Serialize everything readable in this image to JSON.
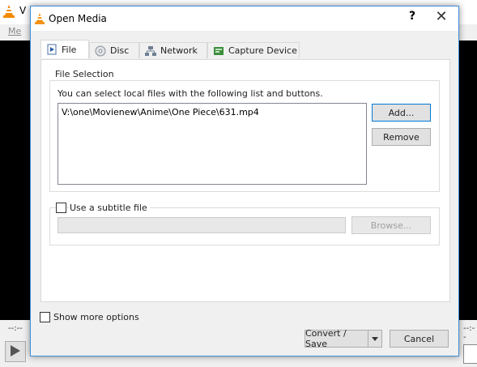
{
  "background_window": {
    "title": "V",
    "menu": "Me",
    "time_left": "--:--",
    "time_right": "--:--"
  },
  "dialog": {
    "title": "Open Media",
    "help_glyph": "?",
    "close_glyph": "✕"
  },
  "tabs": [
    {
      "label": "File",
      "icon": "file-play-icon",
      "active": true
    },
    {
      "label": "Disc",
      "icon": "disc-icon",
      "active": false
    },
    {
      "label": "Network",
      "icon": "network-icon",
      "active": false
    },
    {
      "label": "Capture Device",
      "icon": "capture-device-icon",
      "active": false
    }
  ],
  "file_selection": {
    "group_label": "File Selection",
    "hint": "You can select local files with the following list and buttons.",
    "files": [
      "V:\\one\\Movienew\\Anime\\One Piece\\631.mp4"
    ],
    "add_label": "Add...",
    "remove_label": "Remove"
  },
  "subtitle": {
    "checkbox_label": "Use a subtitle file",
    "checked": false,
    "path_value": "",
    "browse_label": "Browse..."
  },
  "footer": {
    "show_more_label": "Show more options",
    "convert_label": "Convert / Save",
    "cancel_label": "Cancel"
  },
  "colors": {
    "accent": "#0078d7",
    "dialog_border": "#3c8ddb",
    "vlc_orange": "#f28a00"
  }
}
